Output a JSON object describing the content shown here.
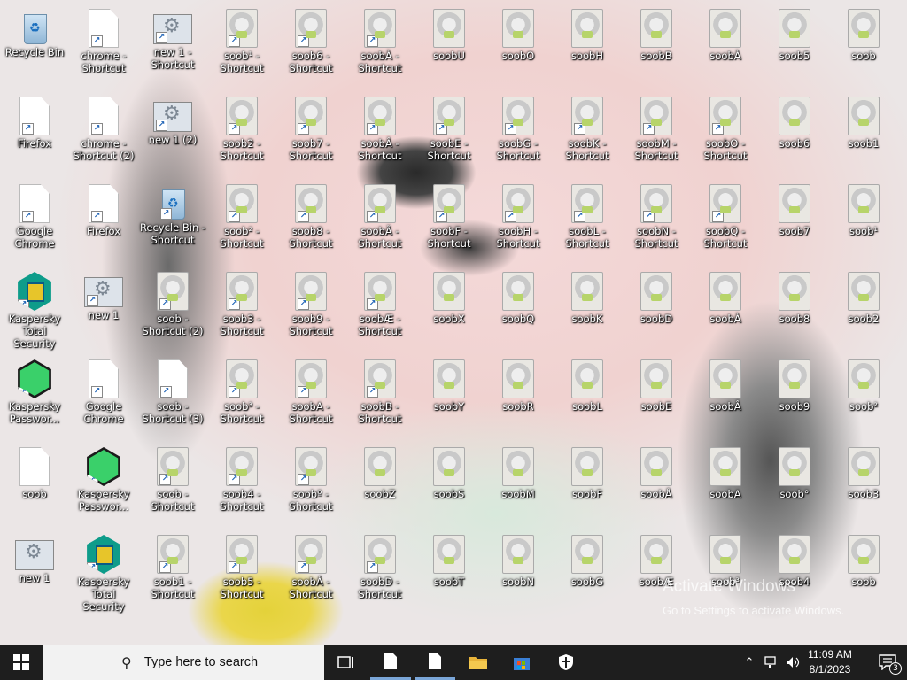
{
  "desktop": {
    "icons": [
      {
        "label": "Recycle Bin",
        "icon": "recycle-bin-icon",
        "shortcut": false
      },
      {
        "label": "chrome - Shortcut",
        "icon": "document-icon",
        "shortcut": true
      },
      {
        "label": "new 1 - Shortcut",
        "icon": "settings-file-icon",
        "shortcut": true
      },
      {
        "label": "soob¹ - Shortcut",
        "icon": "soob-image-icon",
        "shortcut": true
      },
      {
        "label": "soob6 - Shortcut",
        "icon": "soob-image-icon",
        "shortcut": true
      },
      {
        "label": "soobÀ - Shortcut",
        "icon": "soob-image-icon",
        "shortcut": true
      },
      {
        "label": "soobU",
        "icon": "soob-image-icon",
        "shortcut": false
      },
      {
        "label": "soobO",
        "icon": "soob-image-icon",
        "shortcut": false
      },
      {
        "label": "soobH",
        "icon": "soob-image-icon",
        "shortcut": false
      },
      {
        "label": "soobB",
        "icon": "soob-image-icon",
        "shortcut": false
      },
      {
        "label": "soobÀ",
        "icon": "soob-image-icon",
        "shortcut": false
      },
      {
        "label": "soob5",
        "icon": "soob-image-icon",
        "shortcut": false
      },
      {
        "label": "soob",
        "icon": "soob-image-icon",
        "shortcut": false
      },
      {
        "label": "Firefox",
        "icon": "document-icon",
        "shortcut": true
      },
      {
        "label": "chrome - Shortcut (2)",
        "icon": "document-icon",
        "shortcut": true
      },
      {
        "label": "new 1 (2)",
        "icon": "settings-file-icon",
        "shortcut": true
      },
      {
        "label": "soob2 - Shortcut",
        "icon": "soob-image-icon",
        "shortcut": true
      },
      {
        "label": "soob7 - Shortcut",
        "icon": "soob-image-icon",
        "shortcut": true
      },
      {
        "label": "soobÂ - Shortcut",
        "icon": "soob-image-icon",
        "shortcut": true
      },
      {
        "label": "soobE - Shortcut",
        "icon": "soob-image-icon",
        "shortcut": true
      },
      {
        "label": "soobG - Shortcut",
        "icon": "soob-image-icon",
        "shortcut": true
      },
      {
        "label": "soobK - Shortcut",
        "icon": "soob-image-icon",
        "shortcut": true
      },
      {
        "label": "soobM - Shortcut",
        "icon": "soob-image-icon",
        "shortcut": true
      },
      {
        "label": "soobO - Shortcut",
        "icon": "soob-image-icon",
        "shortcut": true
      },
      {
        "label": "soob6",
        "icon": "soob-image-icon",
        "shortcut": false
      },
      {
        "label": "soob1",
        "icon": "soob-image-icon",
        "shortcut": false
      },
      {
        "label": "Google Chrome",
        "icon": "document-icon",
        "shortcut": true
      },
      {
        "label": "Firefox",
        "icon": "document-icon",
        "shortcut": true
      },
      {
        "label": "Recycle Bin - Shortcut",
        "icon": "recycle-bin-icon",
        "shortcut": true
      },
      {
        "label": "soob² - Shortcut",
        "icon": "soob-image-icon",
        "shortcut": true
      },
      {
        "label": "soob8 - Shortcut",
        "icon": "soob-image-icon",
        "shortcut": true
      },
      {
        "label": "soobÃ - Shortcut",
        "icon": "soob-image-icon",
        "shortcut": true
      },
      {
        "label": "soobF - Shortcut",
        "icon": "soob-image-icon",
        "shortcut": true
      },
      {
        "label": "soobH - Shortcut",
        "icon": "soob-image-icon",
        "shortcut": true
      },
      {
        "label": "soobL - Shortcut",
        "icon": "soob-image-icon",
        "shortcut": true
      },
      {
        "label": "soobN - Shortcut",
        "icon": "soob-image-icon",
        "shortcut": true
      },
      {
        "label": "soobQ - Shortcut",
        "icon": "soob-image-icon",
        "shortcut": true
      },
      {
        "label": "soob7",
        "icon": "soob-image-icon",
        "shortcut": false
      },
      {
        "label": "soob¹",
        "icon": "soob-image-icon",
        "shortcut": false
      },
      {
        "label": "Kaspersky Total Security",
        "icon": "kaspersky-total-security-icon",
        "shortcut": true
      },
      {
        "label": "new 1",
        "icon": "settings-file-icon",
        "shortcut": true
      },
      {
        "label": "soob - Shortcut (2)",
        "icon": "soob-image-icon",
        "shortcut": true
      },
      {
        "label": "soob3 - Shortcut",
        "icon": "soob-image-icon",
        "shortcut": true
      },
      {
        "label": "soob9 - Shortcut",
        "icon": "soob-image-icon",
        "shortcut": true
      },
      {
        "label": "soobÆ - Shortcut",
        "icon": "soob-image-icon",
        "shortcut": true
      },
      {
        "label": "soobX",
        "icon": "soob-image-icon",
        "shortcut": false
      },
      {
        "label": "soobQ",
        "icon": "soob-image-icon",
        "shortcut": false
      },
      {
        "label": "soobK",
        "icon": "soob-image-icon",
        "shortcut": false
      },
      {
        "label": "soobD",
        "icon": "soob-image-icon",
        "shortcut": false
      },
      {
        "label": "soobÀ",
        "icon": "soob-image-icon",
        "shortcut": false
      },
      {
        "label": "soob8",
        "icon": "soob-image-icon",
        "shortcut": false
      },
      {
        "label": "soob2",
        "icon": "soob-image-icon",
        "shortcut": false
      },
      {
        "label": "Kaspersky Passwor...",
        "icon": "kaspersky-password-manager-icon",
        "shortcut": true
      },
      {
        "label": "Google Chrome",
        "icon": "document-icon",
        "shortcut": true
      },
      {
        "label": "soob - Shortcut (3)",
        "icon": "document-icon",
        "shortcut": true
      },
      {
        "label": "soob³ - Shortcut",
        "icon": "soob-image-icon",
        "shortcut": true
      },
      {
        "label": "soobA - Shortcut",
        "icon": "soob-image-icon",
        "shortcut": true
      },
      {
        "label": "soobB - Shortcut",
        "icon": "soob-image-icon",
        "shortcut": true
      },
      {
        "label": "soobY",
        "icon": "soob-image-icon",
        "shortcut": false
      },
      {
        "label": "soobR",
        "icon": "soob-image-icon",
        "shortcut": false
      },
      {
        "label": "soobL",
        "icon": "soob-image-icon",
        "shortcut": false
      },
      {
        "label": "soobE",
        "icon": "soob-image-icon",
        "shortcut": false
      },
      {
        "label": "soobÂ",
        "icon": "soob-image-icon",
        "shortcut": false
      },
      {
        "label": "soob9",
        "icon": "soob-image-icon",
        "shortcut": false
      },
      {
        "label": "soob²",
        "icon": "soob-image-icon",
        "shortcut": false
      },
      {
        "label": "soob",
        "icon": "document-icon",
        "shortcut": false
      },
      {
        "label": "Kaspersky Passwor...",
        "icon": "kaspersky-password-manager-icon",
        "shortcut": true
      },
      {
        "label": "soob - Shortcut",
        "icon": "soob-image-icon",
        "shortcut": true
      },
      {
        "label": "soob4 - Shortcut",
        "icon": "soob-image-icon",
        "shortcut": true
      },
      {
        "label": "soobº - Shortcut",
        "icon": "soob-image-icon",
        "shortcut": true
      },
      {
        "label": "soobZ",
        "icon": "soob-image-icon",
        "shortcut": false
      },
      {
        "label": "soobS",
        "icon": "soob-image-icon",
        "shortcut": false
      },
      {
        "label": "soobM",
        "icon": "soob-image-icon",
        "shortcut": false
      },
      {
        "label": "soobF",
        "icon": "soob-image-icon",
        "shortcut": false
      },
      {
        "label": "soobÅ",
        "icon": "soob-image-icon",
        "shortcut": false
      },
      {
        "label": "soobA",
        "icon": "soob-image-icon",
        "shortcut": false
      },
      {
        "label": "soob°",
        "icon": "soob-image-icon",
        "shortcut": false
      },
      {
        "label": "soob3",
        "icon": "soob-image-icon",
        "shortcut": false
      },
      {
        "label": "new 1",
        "icon": "settings-file-icon",
        "shortcut": false
      },
      {
        "label": "Kaspersky Total Security",
        "icon": "kaspersky-total-security-icon",
        "shortcut": true
      },
      {
        "label": "soob1 - Shortcut",
        "icon": "soob-image-icon",
        "shortcut": true
      },
      {
        "label": "soob5 - Shortcut",
        "icon": "soob-image-icon",
        "shortcut": true
      },
      {
        "label": "soobÁ - Shortcut",
        "icon": "soob-image-icon",
        "shortcut": true
      },
      {
        "label": "soobD - Shortcut",
        "icon": "soob-image-icon",
        "shortcut": true
      },
      {
        "label": "soobT",
        "icon": "soob-image-icon",
        "shortcut": false
      },
      {
        "label": "soobN",
        "icon": "soob-image-icon",
        "shortcut": false
      },
      {
        "label": "soobG",
        "icon": "soob-image-icon",
        "shortcut": false
      },
      {
        "label": "soobÆ",
        "icon": "soob-image-icon",
        "shortcut": false
      },
      {
        "label": "soob³",
        "icon": "soob-image-icon",
        "shortcut": false
      },
      {
        "label": "soob4",
        "icon": "soob-image-icon",
        "shortcut": false
      },
      {
        "label": "soob",
        "icon": "soob-image-icon",
        "shortcut": false
      }
    ],
    "watermark": {
      "line1": "Activate Windows",
      "line2": "Go to Settings to activate Windows."
    }
  },
  "taskbar": {
    "start_icon": "windows-logo-icon",
    "search_placeholder": "Type here to search",
    "apps": [
      {
        "name": "task-view-icon",
        "active": false
      },
      {
        "name": "document-app-icon",
        "active": true
      },
      {
        "name": "document-app-icon",
        "active": true
      },
      {
        "name": "file-explorer-icon",
        "active": false
      },
      {
        "name": "microsoft-store-icon",
        "active": false
      },
      {
        "name": "kaspersky-shield-icon",
        "active": false
      }
    ],
    "time": "11:09 AM",
    "date": "8/1/2023",
    "notification_count": "3"
  }
}
